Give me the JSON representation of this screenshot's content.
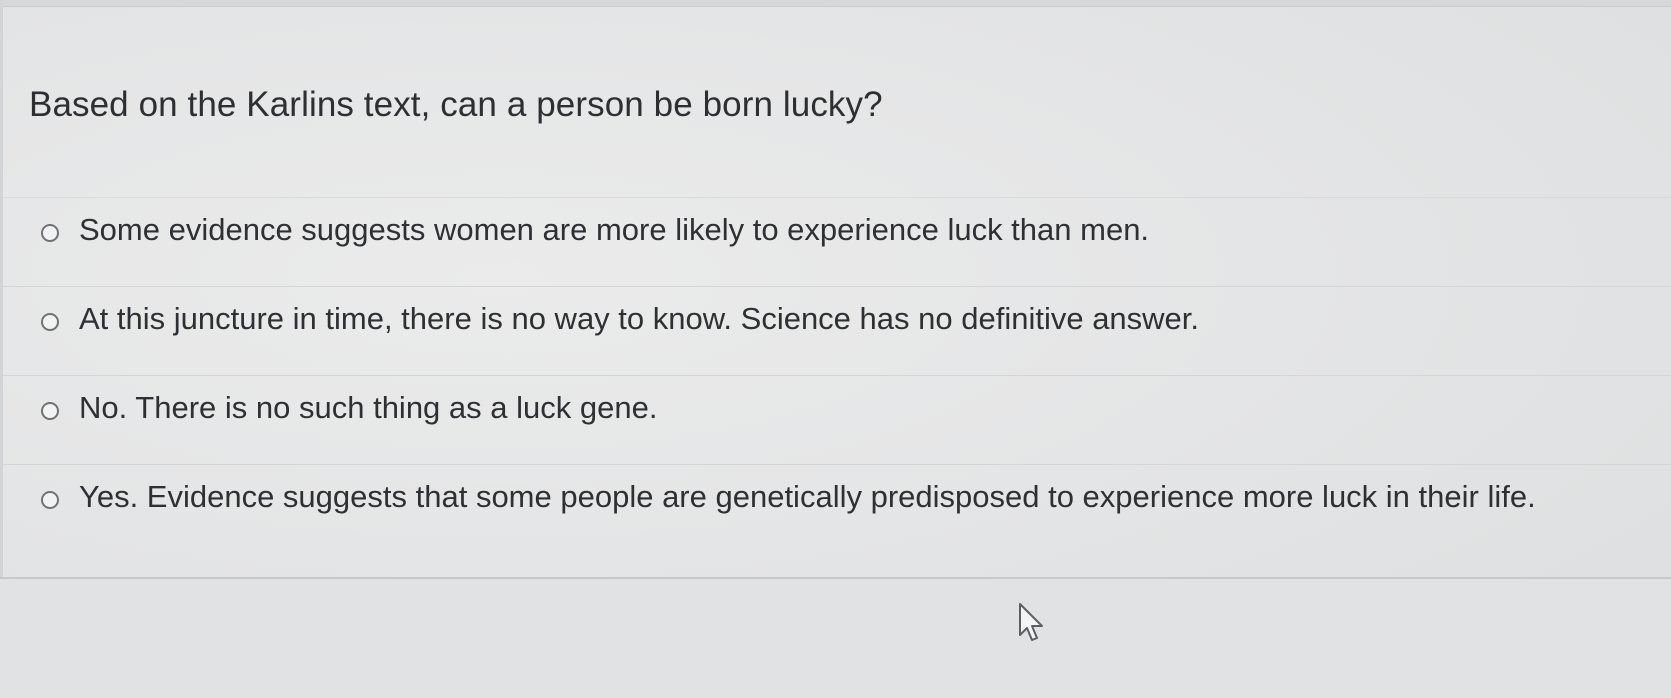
{
  "question": {
    "text": "Based on the Karlins text, can a person be born lucky?"
  },
  "answers": [
    {
      "label": "Some evidence suggests women are more likely to experience luck than men.",
      "selected": false
    },
    {
      "label": "At this juncture in time, there is no way to know. Science has no definitive answer.",
      "selected": false
    },
    {
      "label": "No. There is no such thing as a luck gene.",
      "selected": false
    },
    {
      "label": "Yes. Evidence suggests that some people are genetically predisposed to experience more luck in their life.",
      "selected": false
    }
  ],
  "icons": {
    "cursor": "mouse-pointer-icon",
    "radio": "radio-unselected-icon"
  }
}
